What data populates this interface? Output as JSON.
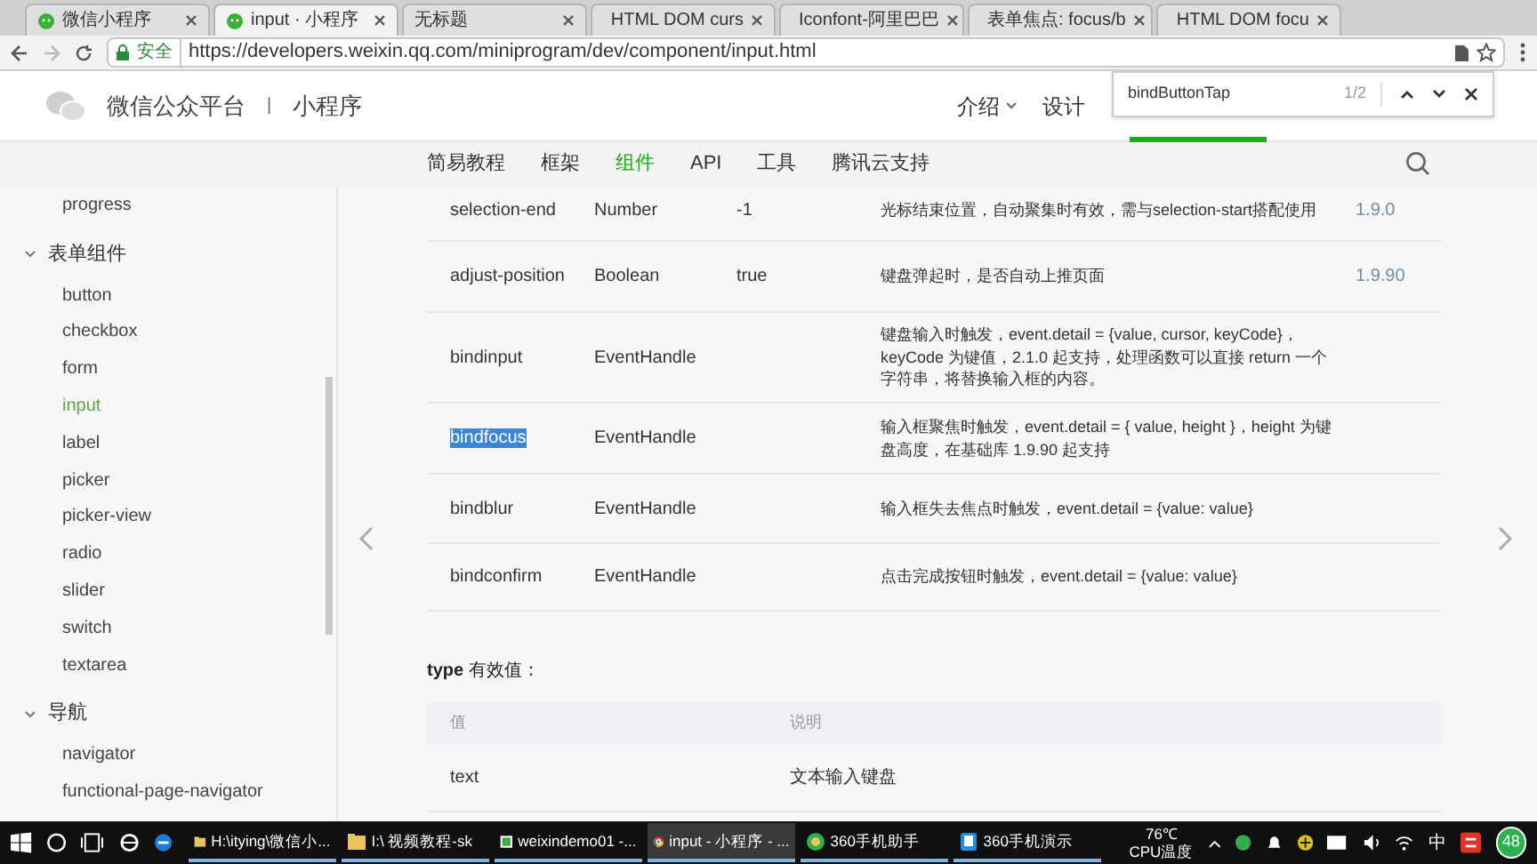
{
  "browser_tabs": [
    {
      "title": "微信小程序",
      "kind": "chat",
      "selected": false
    },
    {
      "title": "input · 小程序",
      "kind": "chat",
      "selected": true
    },
    {
      "title": "无标题",
      "kind": "plain",
      "selected": false
    },
    {
      "title": "HTML DOM curs",
      "kind": "doc",
      "selected": false
    },
    {
      "title": "Iconfont-阿里巴巴",
      "kind": "orange",
      "selected": false
    },
    {
      "title": "表单焦点: focus/b",
      "kind": "c",
      "selected": false
    },
    {
      "title": "HTML DOM focu",
      "kind": "doc",
      "selected": false
    }
  ],
  "address_bar": {
    "security": "安全",
    "url": "https://developers.weixin.qq.com/miniprogram/dev/component/input.html"
  },
  "header": {
    "brand": "微信公众平台",
    "separator": "|",
    "product": "小程序",
    "links": [
      "介绍",
      "设计"
    ]
  },
  "find_bar": {
    "query": "bindButtonTap",
    "count": "1/2"
  },
  "nav": [
    {
      "label": "简易教程",
      "selected": false
    },
    {
      "label": "框架",
      "selected": false
    },
    {
      "label": "组件",
      "selected": true
    },
    {
      "label": "API",
      "selected": false
    },
    {
      "label": "工具",
      "selected": false
    },
    {
      "label": "腾讯云支持",
      "selected": false
    }
  ],
  "sidebar": {
    "items": [
      {
        "label": "progress",
        "selected": false
      },
      {
        "label": "表单组件",
        "expanded": true,
        "children": [
          {
            "label": "button",
            "selected": false
          },
          {
            "label": "checkbox",
            "selected": false
          },
          {
            "label": "form",
            "selected": false
          },
          {
            "label": "input",
            "selected": true
          },
          {
            "label": "label",
            "selected": false
          },
          {
            "label": "picker",
            "selected": false
          },
          {
            "label": "picker-view",
            "selected": false
          },
          {
            "label": "radio",
            "selected": false
          },
          {
            "label": "slider",
            "selected": false
          },
          {
            "label": "switch",
            "selected": false
          },
          {
            "label": "textarea",
            "selected": false
          }
        ]
      },
      {
        "label": "导航",
        "expanded": true,
        "children": [
          {
            "label": "navigator",
            "selected": false
          },
          {
            "label": "functional-page-navigator",
            "selected": false
          }
        ]
      }
    ]
  },
  "properties_table": {
    "rows": [
      {
        "name": "selection-end",
        "type": "Number",
        "default": "-1",
        "description": "光标结束位置，自动聚集时有效，需与selection-start搭配使用",
        "version": "1.9.0",
        "highlighted": false
      },
      {
        "name": "adjust-position",
        "type": "Boolean",
        "default": "true",
        "description": "键盘弹起时，是否自动上推页面",
        "version": "1.9.90",
        "highlighted": false
      },
      {
        "name": "bindinput",
        "type": "EventHandle",
        "description": "键盘输入时触发，event.detail = {value, cursor, keyCode}，keyCode 为键值，2.1.0 起支持，处理函数可以直接 return 一个字符串，将替换输入框的内容。",
        "highlighted": false
      },
      {
        "name": "bindfocus",
        "type": "EventHandle",
        "description": "输入框聚焦时触发，event.detail = { value, height }，height 为键盘高度，在基础库 1.9.90 起支持",
        "highlighted": true
      },
      {
        "name": "bindblur",
        "type": "EventHandle",
        "description": "输入框失去焦点时触发，event.detail = {value: value}",
        "highlighted": false
      },
      {
        "name": "bindconfirm",
        "type": "EventHandle",
        "description": "点击完成按钮时触发，event.detail = {value: value}",
        "highlighted": false
      }
    ]
  },
  "type_section": {
    "title": "**type** 有效值：",
    "columns": [
      "值",
      "说明"
    ],
    "rows": [
      [
        "text",
        "文本输入键盘"
      ]
    ]
  },
  "taskbar": {
    "windows": [
      {
        "label": "H:\\itying\\微信小...",
        "kind": "folder",
        "selected": false
      },
      {
        "label": "I:\\ 视频教程-sk",
        "kind": "folder",
        "selected": false
      },
      {
        "label": "weixindemo01 -...",
        "kind": "app",
        "selected": false
      },
      {
        "label": "input - 小程序 - ...",
        "kind": "chrome",
        "selected": true
      },
      {
        "label": "360手机助手",
        "kind": "ball",
        "selected": false
      },
      {
        "label": "360手机演示",
        "kind": "phone",
        "selected": false
      }
    ],
    "temperature": "76℃",
    "temperature_label": "CPU温度",
    "ime": "中",
    "badge": "48"
  }
}
